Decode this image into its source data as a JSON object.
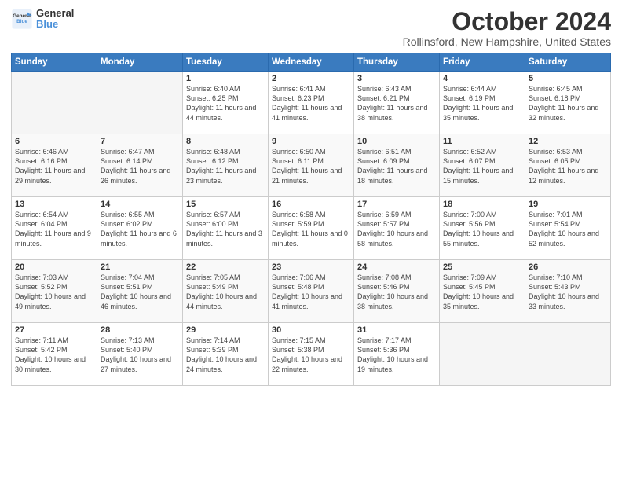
{
  "logo": {
    "line1": "General",
    "line2": "Blue"
  },
  "title": "October 2024",
  "location": "Rollinsford, New Hampshire, United States",
  "weekdays": [
    "Sunday",
    "Monday",
    "Tuesday",
    "Wednesday",
    "Thursday",
    "Friday",
    "Saturday"
  ],
  "weeks": [
    [
      {
        "day": "",
        "empty": true
      },
      {
        "day": "",
        "empty": true
      },
      {
        "day": "1",
        "info": "Sunrise: 6:40 AM\nSunset: 6:25 PM\nDaylight: 11 hours and 44 minutes."
      },
      {
        "day": "2",
        "info": "Sunrise: 6:41 AM\nSunset: 6:23 PM\nDaylight: 11 hours and 41 minutes."
      },
      {
        "day": "3",
        "info": "Sunrise: 6:43 AM\nSunset: 6:21 PM\nDaylight: 11 hours and 38 minutes."
      },
      {
        "day": "4",
        "info": "Sunrise: 6:44 AM\nSunset: 6:19 PM\nDaylight: 11 hours and 35 minutes."
      },
      {
        "day": "5",
        "info": "Sunrise: 6:45 AM\nSunset: 6:18 PM\nDaylight: 11 hours and 32 minutes."
      }
    ],
    [
      {
        "day": "6",
        "info": "Sunrise: 6:46 AM\nSunset: 6:16 PM\nDaylight: 11 hours and 29 minutes."
      },
      {
        "day": "7",
        "info": "Sunrise: 6:47 AM\nSunset: 6:14 PM\nDaylight: 11 hours and 26 minutes."
      },
      {
        "day": "8",
        "info": "Sunrise: 6:48 AM\nSunset: 6:12 PM\nDaylight: 11 hours and 23 minutes."
      },
      {
        "day": "9",
        "info": "Sunrise: 6:50 AM\nSunset: 6:11 PM\nDaylight: 11 hours and 21 minutes."
      },
      {
        "day": "10",
        "info": "Sunrise: 6:51 AM\nSunset: 6:09 PM\nDaylight: 11 hours and 18 minutes."
      },
      {
        "day": "11",
        "info": "Sunrise: 6:52 AM\nSunset: 6:07 PM\nDaylight: 11 hours and 15 minutes."
      },
      {
        "day": "12",
        "info": "Sunrise: 6:53 AM\nSunset: 6:05 PM\nDaylight: 11 hours and 12 minutes."
      }
    ],
    [
      {
        "day": "13",
        "info": "Sunrise: 6:54 AM\nSunset: 6:04 PM\nDaylight: 11 hours and 9 minutes."
      },
      {
        "day": "14",
        "info": "Sunrise: 6:55 AM\nSunset: 6:02 PM\nDaylight: 11 hours and 6 minutes."
      },
      {
        "day": "15",
        "info": "Sunrise: 6:57 AM\nSunset: 6:00 PM\nDaylight: 11 hours and 3 minutes."
      },
      {
        "day": "16",
        "info": "Sunrise: 6:58 AM\nSunset: 5:59 PM\nDaylight: 11 hours and 0 minutes."
      },
      {
        "day": "17",
        "info": "Sunrise: 6:59 AM\nSunset: 5:57 PM\nDaylight: 10 hours and 58 minutes."
      },
      {
        "day": "18",
        "info": "Sunrise: 7:00 AM\nSunset: 5:56 PM\nDaylight: 10 hours and 55 minutes."
      },
      {
        "day": "19",
        "info": "Sunrise: 7:01 AM\nSunset: 5:54 PM\nDaylight: 10 hours and 52 minutes."
      }
    ],
    [
      {
        "day": "20",
        "info": "Sunrise: 7:03 AM\nSunset: 5:52 PM\nDaylight: 10 hours and 49 minutes."
      },
      {
        "day": "21",
        "info": "Sunrise: 7:04 AM\nSunset: 5:51 PM\nDaylight: 10 hours and 46 minutes."
      },
      {
        "day": "22",
        "info": "Sunrise: 7:05 AM\nSunset: 5:49 PM\nDaylight: 10 hours and 44 minutes."
      },
      {
        "day": "23",
        "info": "Sunrise: 7:06 AM\nSunset: 5:48 PM\nDaylight: 10 hours and 41 minutes."
      },
      {
        "day": "24",
        "info": "Sunrise: 7:08 AM\nSunset: 5:46 PM\nDaylight: 10 hours and 38 minutes."
      },
      {
        "day": "25",
        "info": "Sunrise: 7:09 AM\nSunset: 5:45 PM\nDaylight: 10 hours and 35 minutes."
      },
      {
        "day": "26",
        "info": "Sunrise: 7:10 AM\nSunset: 5:43 PM\nDaylight: 10 hours and 33 minutes."
      }
    ],
    [
      {
        "day": "27",
        "info": "Sunrise: 7:11 AM\nSunset: 5:42 PM\nDaylight: 10 hours and 30 minutes."
      },
      {
        "day": "28",
        "info": "Sunrise: 7:13 AM\nSunset: 5:40 PM\nDaylight: 10 hours and 27 minutes."
      },
      {
        "day": "29",
        "info": "Sunrise: 7:14 AM\nSunset: 5:39 PM\nDaylight: 10 hours and 24 minutes."
      },
      {
        "day": "30",
        "info": "Sunrise: 7:15 AM\nSunset: 5:38 PM\nDaylight: 10 hours and 22 minutes."
      },
      {
        "day": "31",
        "info": "Sunrise: 7:17 AM\nSunset: 5:36 PM\nDaylight: 10 hours and 19 minutes."
      },
      {
        "day": "",
        "empty": true
      },
      {
        "day": "",
        "empty": true
      }
    ]
  ]
}
